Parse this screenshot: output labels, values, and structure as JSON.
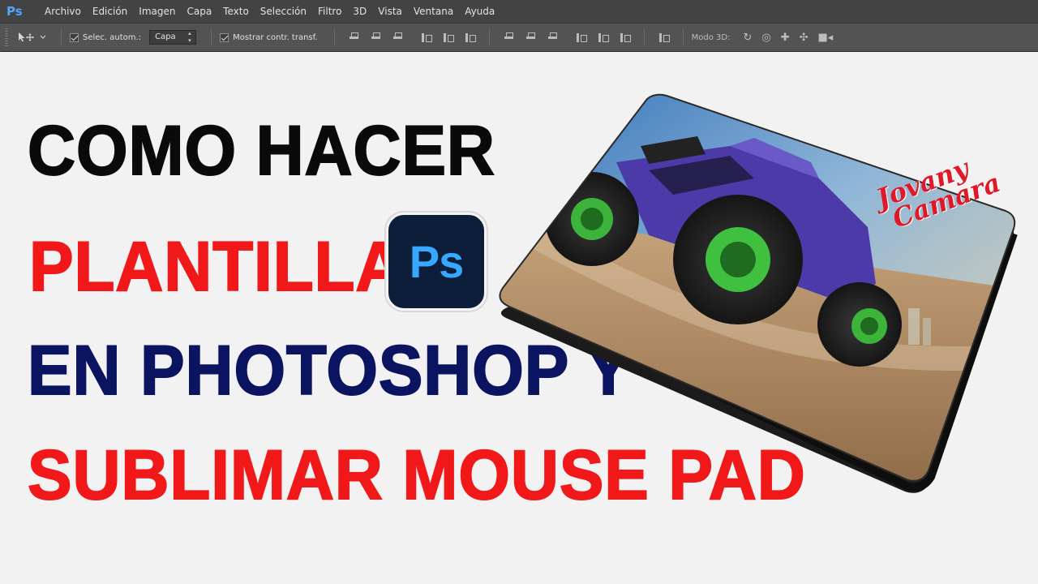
{
  "app": {
    "logo": "Ps",
    "menu": [
      "Archivo",
      "Edición",
      "Imagen",
      "Capa",
      "Texto",
      "Selección",
      "Filtro",
      "3D",
      "Vista",
      "Ventana",
      "Ayuda"
    ]
  },
  "options_bar": {
    "move_tool_icon": "move-icon",
    "auto_select_label": "Selec. autom.:",
    "auto_select_checked": true,
    "auto_select_value": "Capa",
    "show_transform_label": "Mostrar contr. transf.",
    "show_transform_checked": true,
    "mode3d_label": "Modo 3D:"
  },
  "thumbnail": {
    "line1": "COMO HACER",
    "line2": "PLANTILLA",
    "line3": "EN PHOTOSHOP Y",
    "line4": "SUBLIMAR MOUSE PAD",
    "badge_text": "Ps",
    "pad_brand_line1": "Jovany",
    "pad_brand_line2": "Camara",
    "colors": {
      "black": "#0a0a0a",
      "red": "#f01818",
      "navy": "#0a1460",
      "badge_bg": "#0c1e3a",
      "badge_text": "#37a8ff"
    }
  }
}
